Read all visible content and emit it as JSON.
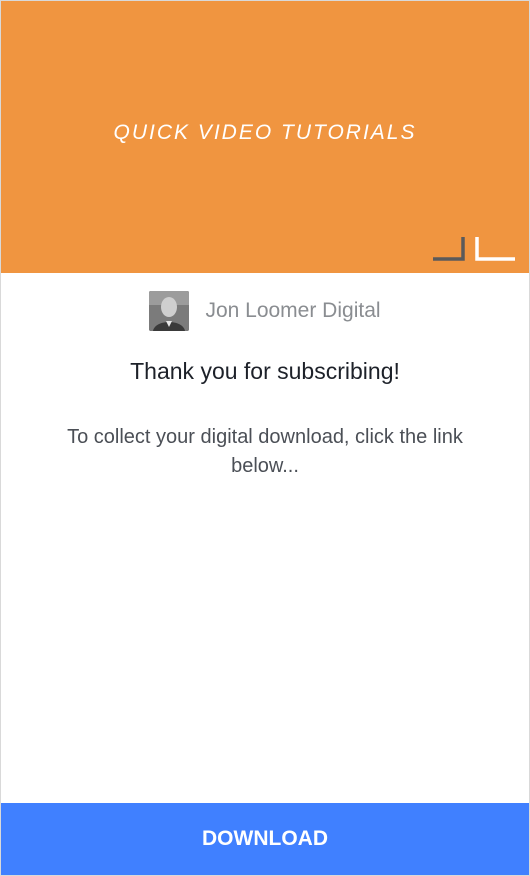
{
  "header": {
    "title": "QUICK VIDEO TUTORIALS",
    "logo_icon": "jl-logo-icon",
    "background_color": "#f09540"
  },
  "page": {
    "name": "Jon Loomer Digital",
    "avatar_icon": "profile-photo"
  },
  "message": {
    "heading": "Thank you for subscribing!",
    "body": "To collect your digital download, click the link below..."
  },
  "action": {
    "button_label": "DOWNLOAD",
    "button_color": "#4080ff"
  }
}
